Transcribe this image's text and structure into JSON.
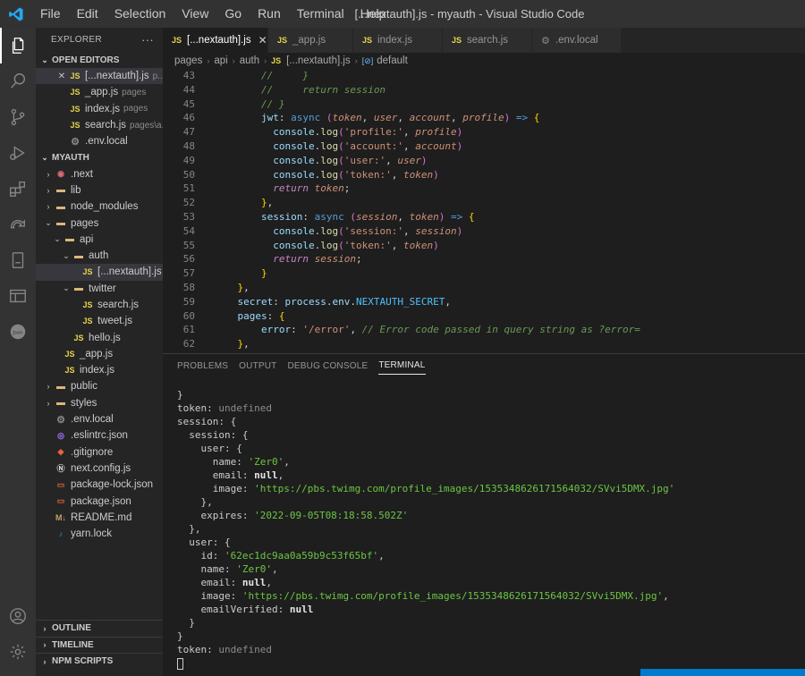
{
  "menu": [
    "File",
    "Edit",
    "Selection",
    "View",
    "Go",
    "Run",
    "Terminal",
    "Help"
  ],
  "window_title": "[...nextauth].js - myauth - Visual Studio Code",
  "explorer": {
    "title": "EXPLORER",
    "more": "···",
    "open_editors_label": "OPEN EDITORS",
    "open_editors": [
      {
        "name": "[...nextauth].js",
        "hint": "p...",
        "icon": "JS",
        "close": "✕"
      },
      {
        "name": "_app.js",
        "hint": "pages",
        "icon": "JS"
      },
      {
        "name": "index.js",
        "hint": "pages",
        "icon": "JS"
      },
      {
        "name": "search.js",
        "hint": "pages\\a...",
        "icon": "JS"
      },
      {
        "name": ".env.local",
        "hint": "",
        "icon": "⚙"
      }
    ],
    "project_label": "MYAUTH",
    "tree": [
      {
        "name": ".next",
        "depth": 1,
        "chev": "›",
        "icon": "◉"
      },
      {
        "name": "lib",
        "depth": 1,
        "chev": "›",
        "icon": "▬"
      },
      {
        "name": "node_modules",
        "depth": 1,
        "chev": "›",
        "icon": "▬"
      },
      {
        "name": "pages",
        "depth": 1,
        "chev": "⌄",
        "icon": "▬"
      },
      {
        "name": "api",
        "depth": 2,
        "chev": "⌄",
        "icon": "▬"
      },
      {
        "name": "auth",
        "depth": 3,
        "chev": "⌄",
        "icon": "▬"
      },
      {
        "name": "[...nextauth].js",
        "depth": 4,
        "chev": "",
        "icon": "JS",
        "selected": true
      },
      {
        "name": "twitter",
        "depth": 3,
        "chev": "⌄",
        "icon": "▬"
      },
      {
        "name": "search.js",
        "depth": 4,
        "chev": "",
        "icon": "JS"
      },
      {
        "name": "tweet.js",
        "depth": 4,
        "chev": "",
        "icon": "JS"
      },
      {
        "name": "hello.js",
        "depth": 3,
        "chev": "",
        "icon": "JS"
      },
      {
        "name": "_app.js",
        "depth": 2,
        "chev": "",
        "icon": "JS"
      },
      {
        "name": "index.js",
        "depth": 2,
        "chev": "",
        "icon": "JS"
      },
      {
        "name": "public",
        "depth": 1,
        "chev": "›",
        "icon": "▬"
      },
      {
        "name": "styles",
        "depth": 1,
        "chev": "›",
        "icon": "▬"
      },
      {
        "name": ".env.local",
        "depth": 1,
        "chev": "",
        "icon": "⚙"
      },
      {
        "name": ".eslintrc.json",
        "depth": 1,
        "chev": "",
        "icon": "◎"
      },
      {
        "name": ".gitignore",
        "depth": 1,
        "chev": "",
        "icon": "◆"
      },
      {
        "name": "next.config.js",
        "depth": 1,
        "chev": "",
        "icon": "Ⓝ"
      },
      {
        "name": "package-lock.json",
        "depth": 1,
        "chev": "",
        "icon": "▭"
      },
      {
        "name": "package.json",
        "depth": 1,
        "chev": "",
        "icon": "▭"
      },
      {
        "name": "README.md",
        "depth": 1,
        "chev": "",
        "icon": "M↓"
      },
      {
        "name": "yarn.lock",
        "depth": 1,
        "chev": "",
        "icon": "♪"
      }
    ],
    "bottom_sections": [
      "OUTLINE",
      "TIMELINE",
      "NPM SCRIPTS"
    ]
  },
  "tabs": [
    {
      "label": "[...nextauth].js",
      "icon": "JS",
      "active": true,
      "close": "✕"
    },
    {
      "label": "_app.js",
      "icon": "JS"
    },
    {
      "label": "index.js",
      "icon": "JS"
    },
    {
      "label": "search.js",
      "icon": "JS"
    },
    {
      "label": ".env.local",
      "icon": "⚙"
    }
  ],
  "breadcrumb": {
    "parts": [
      "pages",
      "api",
      "auth"
    ],
    "file": "[...nextauth].js",
    "file_icon": "JS",
    "symbol_icon": "[⊘]",
    "symbol": "default",
    "sep": "›"
  },
  "editor": {
    "line_numbers": [
      "43",
      "44",
      "45",
      "46",
      "47",
      "48",
      "49",
      "50",
      "51",
      "52",
      "53",
      "54",
      "55",
      "56",
      "57",
      "58",
      "59",
      "60",
      "61",
      "62"
    ],
    "lines": [
      "        //     }",
      "        //     return session",
      "        // }",
      "        jwt: async (token, user, account, profile) => {",
      "          console.log('profile:', profile)",
      "          console.log('account:', account)",
      "          console.log('user:', user)",
      "          console.log('token:', token)",
      "          return token;",
      "        },",
      "        session: async (session, token) => {",
      "          console.log('session:', session)",
      "          console.log('token:', token)",
      "          return session;",
      "        }",
      "    },",
      "    secret: process.env.NEXTAUTH_SECRET,",
      "    pages: {",
      "        error: '/error', // Error code passed in query string as ?error=",
      "    },"
    ]
  },
  "panel": {
    "tabs": [
      "PROBLEMS",
      "OUTPUT",
      "DEBUG CONSOLE",
      "TERMINAL"
    ],
    "active_tab": "TERMINAL",
    "terminal_lines": [
      "}",
      "token: undefined",
      "session: {",
      "  session: {",
      "    user: {",
      "      name: 'Zer0',",
      "      email: null,",
      "      image: 'https://pbs.twimg.com/profile_images/1535348626171564032/SVvi5DMX.jpg'",
      "    },",
      "    expires: '2022-09-05T08:18:58.502Z'",
      "  },",
      "  user: {",
      "    id: '62ec1dc9aa0a59b9c53f65bf',",
      "    name: 'Zer0',",
      "    email: null,",
      "    image: 'https://pbs.twimg.com/profile_images/1535348626171564032/SVvi5DMX.jpg',",
      "    emailVerified: null",
      "  }",
      "}",
      "token: undefined",
      ""
    ]
  }
}
